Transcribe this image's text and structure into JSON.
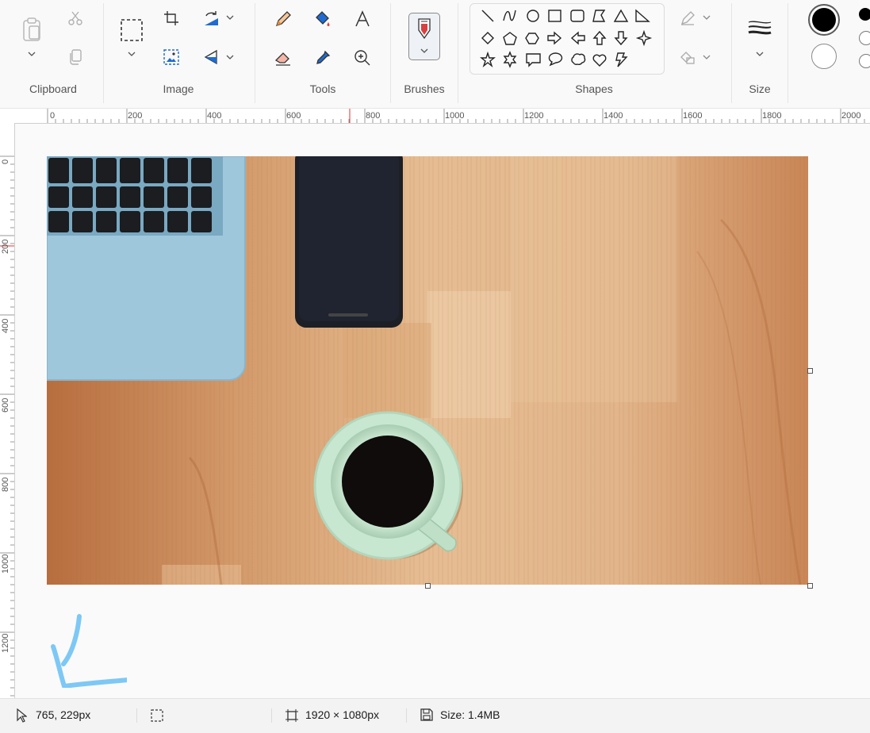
{
  "ribbon": {
    "groups": [
      {
        "label": "Clipboard"
      },
      {
        "label": "Image"
      },
      {
        "label": "Tools"
      },
      {
        "label": "Brushes"
      },
      {
        "label": "Shapes"
      },
      {
        "label": "Size"
      }
    ]
  },
  "rulers": {
    "horizontal": [
      "0",
      "200",
      "400",
      "600",
      "800",
      "1000",
      "1200",
      "1400",
      "1600",
      "1800",
      "2000"
    ],
    "vertical": [
      "0",
      "200",
      "400",
      "600",
      "800",
      "1000",
      "1200"
    ]
  },
  "status": {
    "cursor": "765, 229px",
    "canvas_size": "1920 × 1080px",
    "file_size": "Size: 1.4MB"
  },
  "colors": {
    "primary": "#000000",
    "secondary": "#ffffff",
    "accent_blue": "#1f6bd1",
    "drawn_stroke": "#7dc8f5"
  }
}
